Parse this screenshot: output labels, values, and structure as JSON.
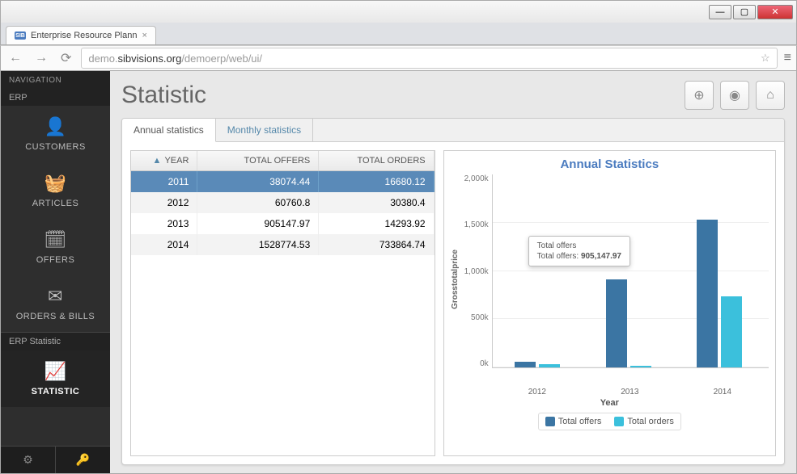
{
  "window": {
    "minimize": "—",
    "maximize": "▢",
    "close": "✕"
  },
  "browser": {
    "favicon": "SIB",
    "tab_title": "Enterprise Resource Plann",
    "tab_close": "×",
    "url_pale": "demo.",
    "url_domain": "sibvisions.org",
    "url_rest": "/demoerp/web/ui/",
    "star": "☆",
    "menu": "≡"
  },
  "sidebar": {
    "nav_label": "NAVIGATION",
    "group_erp": "ERP",
    "group_stat": "ERP Statistic",
    "items": [
      {
        "icon": "👤",
        "label": "CUSTOMERS"
      },
      {
        "icon": "🧺",
        "label": "ARTICLES"
      },
      {
        "icon": "🗓",
        "label": "OFFERS"
      },
      {
        "icon": "✉",
        "label": "ORDERS & BILLS"
      },
      {
        "icon": "📈",
        "label": "STATISTIC"
      }
    ]
  },
  "page": {
    "title": "Statistic",
    "btn_add": "⊕",
    "btn_reload": "◉",
    "btn_home": "⌂"
  },
  "tabs": {
    "annual": "Annual statistics",
    "monthly": "Monthly statistics"
  },
  "table": {
    "sort": "▲",
    "col_year": "YEAR",
    "col_offers": "TOTAL OFFERS",
    "col_orders": "TOTAL ORDERS",
    "rows": [
      {
        "year": "2011",
        "offers": "38074.44",
        "orders": "16680.12",
        "selected": true
      },
      {
        "year": "2012",
        "offers": "60760.8",
        "orders": "30380.4"
      },
      {
        "year": "2013",
        "offers": "905147.97",
        "orders": "14293.92"
      },
      {
        "year": "2014",
        "offers": "1528774.53",
        "orders": "733864.74"
      }
    ]
  },
  "chart_data": {
    "type": "bar",
    "title": "Annual Statistics",
    "xlabel": "Year",
    "ylabel": "Grosstotalprice",
    "categories": [
      "2012",
      "2013",
      "2014"
    ],
    "series": [
      {
        "name": "Total offers",
        "color": "#3b75a3",
        "values": [
          60760.8,
          905147.97,
          1528774.53
        ]
      },
      {
        "name": "Total orders",
        "color": "#3bc0dc",
        "values": [
          30380.4,
          14293.92,
          733864.74
        ]
      }
    ],
    "ylim": [
      0,
      2000000
    ],
    "yticks": [
      "2,000k",
      "1,500k",
      "1,000k",
      "500k",
      "0k"
    ],
    "tooltip": {
      "series": "Total offers",
      "text": "Total offers:",
      "value": "905,147.97"
    }
  }
}
